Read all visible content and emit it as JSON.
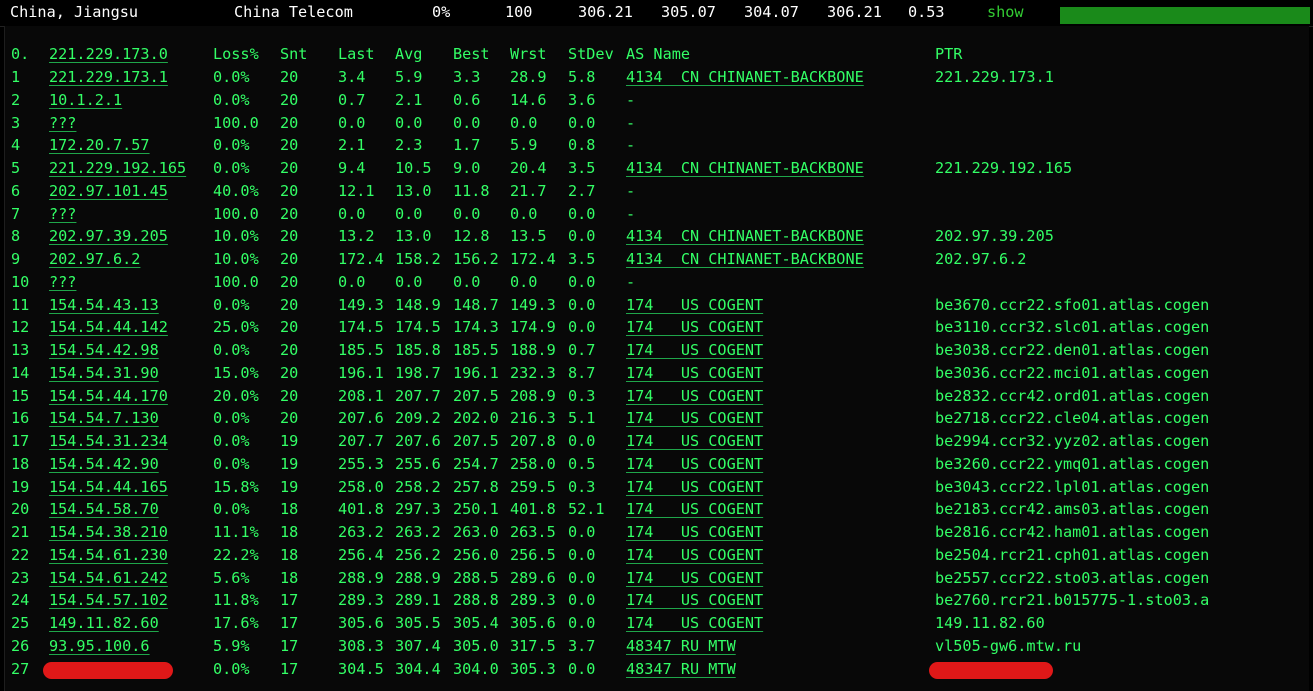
{
  "summary": {
    "location": "China, Jiangsu",
    "isp": "China Telecom",
    "loss": "0%",
    "sent": "100",
    "last": "306.21",
    "avg": "305.07",
    "best": "304.07",
    "worst": "306.21",
    "stdev": "0.53",
    "show_label": "show"
  },
  "headers": {
    "idx": "0.",
    "host": "221.229.173.0",
    "loss": "Loss%",
    "snt": "Snt",
    "last": "Last",
    "avg": "Avg",
    "best": "Best",
    "wrst": "Wrst",
    "stdev": "StDev",
    "as": "AS Name",
    "ptr": "PTR"
  },
  "hops": [
    {
      "idx": "1",
      "host": "221.229.173.1",
      "loss": "0.0%",
      "snt": "20",
      "last": "3.4",
      "avg": "5.9",
      "best": "3.3",
      "wrst": "28.9",
      "std": "5.8",
      "as": "4134  CN CHINANET-BACKBONE",
      "ptr": "221.229.173.1"
    },
    {
      "idx": "2",
      "host": "10.1.2.1",
      "loss": "0.0%",
      "snt": "20",
      "last": "0.7",
      "avg": "2.1",
      "best": "0.6",
      "wrst": "14.6",
      "std": "3.6",
      "as": "-",
      "ptr": ""
    },
    {
      "idx": "3",
      "host": "???",
      "loss": "100.0",
      "snt": "20",
      "last": "0.0",
      "avg": "0.0",
      "best": "0.0",
      "wrst": "0.0",
      "std": "0.0",
      "as": "-",
      "ptr": ""
    },
    {
      "idx": "4",
      "host": "172.20.7.57",
      "loss": "0.0%",
      "snt": "20",
      "last": "2.1",
      "avg": "2.3",
      "best": "1.7",
      "wrst": "5.9",
      "std": "0.8",
      "as": "-",
      "ptr": ""
    },
    {
      "idx": "5",
      "host": "221.229.192.165",
      "loss": "0.0%",
      "snt": "20",
      "last": "9.4",
      "avg": "10.5",
      "best": "9.0",
      "wrst": "20.4",
      "std": "3.5",
      "as": "4134  CN CHINANET-BACKBONE",
      "ptr": "221.229.192.165"
    },
    {
      "idx": "6",
      "host": "202.97.101.45",
      "loss": "40.0%",
      "snt": "20",
      "last": "12.1",
      "avg": "13.0",
      "best": "11.8",
      "wrst": "21.7",
      "std": "2.7",
      "as": "-",
      "ptr": ""
    },
    {
      "idx": "7",
      "host": "???",
      "loss": "100.0",
      "snt": "20",
      "last": "0.0",
      "avg": "0.0",
      "best": "0.0",
      "wrst": "0.0",
      "std": "0.0",
      "as": "-",
      "ptr": ""
    },
    {
      "idx": "8",
      "host": "202.97.39.205",
      "loss": "10.0%",
      "snt": "20",
      "last": "13.2",
      "avg": "13.0",
      "best": "12.8",
      "wrst": "13.5",
      "std": "0.0",
      "as": "4134  CN CHINANET-BACKBONE",
      "ptr": "202.97.39.205"
    },
    {
      "idx": "9",
      "host": "202.97.6.2",
      "loss": "10.0%",
      "snt": "20",
      "last": "172.4",
      "avg": "158.2",
      "best": "156.2",
      "wrst": "172.4",
      "std": "3.5",
      "as": "4134  CN CHINANET-BACKBONE",
      "ptr": "202.97.6.2"
    },
    {
      "idx": "10",
      "host": "???",
      "loss": "100.0",
      "snt": "20",
      "last": "0.0",
      "avg": "0.0",
      "best": "0.0",
      "wrst": "0.0",
      "std": "0.0",
      "as": "-",
      "ptr": ""
    },
    {
      "idx": "11",
      "host": "154.54.43.13",
      "loss": "0.0%",
      "snt": "20",
      "last": "149.3",
      "avg": "148.9",
      "best": "148.7",
      "wrst": "149.3",
      "std": "0.0",
      "as": "174   US COGENT",
      "ptr": "be3670.ccr22.sfo01.atlas.cogen"
    },
    {
      "idx": "12",
      "host": "154.54.44.142",
      "loss": "25.0%",
      "snt": "20",
      "last": "174.5",
      "avg": "174.5",
      "best": "174.3",
      "wrst": "174.9",
      "std": "0.0",
      "as": "174   US COGENT",
      "ptr": "be3110.ccr32.slc01.atlas.cogen"
    },
    {
      "idx": "13",
      "host": "154.54.42.98",
      "loss": "0.0%",
      "snt": "20",
      "last": "185.5",
      "avg": "185.8",
      "best": "185.5",
      "wrst": "188.9",
      "std": "0.7",
      "as": "174   US COGENT",
      "ptr": "be3038.ccr22.den01.atlas.cogen"
    },
    {
      "idx": "14",
      "host": "154.54.31.90",
      "loss": "15.0%",
      "snt": "20",
      "last": "196.1",
      "avg": "198.7",
      "best": "196.1",
      "wrst": "232.3",
      "std": "8.7",
      "as": "174   US COGENT",
      "ptr": "be3036.ccr22.mci01.atlas.cogen"
    },
    {
      "idx": "15",
      "host": "154.54.44.170",
      "loss": "20.0%",
      "snt": "20",
      "last": "208.1",
      "avg": "207.7",
      "best": "207.5",
      "wrst": "208.9",
      "std": "0.3",
      "as": "174   US COGENT",
      "ptr": "be2832.ccr42.ord01.atlas.cogen"
    },
    {
      "idx": "16",
      "host": "154.54.7.130",
      "loss": "0.0%",
      "snt": "20",
      "last": "207.6",
      "avg": "209.2",
      "best": "202.0",
      "wrst": "216.3",
      "std": "5.1",
      "as": "174   US COGENT",
      "ptr": "be2718.ccr22.cle04.atlas.cogen"
    },
    {
      "idx": "17",
      "host": "154.54.31.234",
      "loss": "0.0%",
      "snt": "19",
      "last": "207.7",
      "avg": "207.6",
      "best": "207.5",
      "wrst": "207.8",
      "std": "0.0",
      "as": "174   US COGENT",
      "ptr": "be2994.ccr32.yyz02.atlas.cogen"
    },
    {
      "idx": "18",
      "host": "154.54.42.90",
      "loss": "0.0%",
      "snt": "19",
      "last": "255.3",
      "avg": "255.6",
      "best": "254.7",
      "wrst": "258.0",
      "std": "0.5",
      "as": "174   US COGENT",
      "ptr": "be3260.ccr22.ymq01.atlas.cogen"
    },
    {
      "idx": "19",
      "host": "154.54.44.165",
      "loss": "15.8%",
      "snt": "19",
      "last": "258.0",
      "avg": "258.2",
      "best": "257.8",
      "wrst": "259.5",
      "std": "0.3",
      "as": "174   US COGENT",
      "ptr": "be3043.ccr22.lpl01.atlas.cogen"
    },
    {
      "idx": "20",
      "host": "154.54.58.70",
      "loss": "0.0%",
      "snt": "18",
      "last": "401.8",
      "avg": "297.3",
      "best": "250.1",
      "wrst": "401.8",
      "std": "52.1",
      "as": "174   US COGENT",
      "ptr": "be2183.ccr42.ams03.atlas.cogen"
    },
    {
      "idx": "21",
      "host": "154.54.38.210",
      "loss": "11.1%",
      "snt": "18",
      "last": "263.2",
      "avg": "263.2",
      "best": "263.0",
      "wrst": "263.5",
      "std": "0.0",
      "as": "174   US COGENT",
      "ptr": "be2816.ccr42.ham01.atlas.cogen"
    },
    {
      "idx": "22",
      "host": "154.54.61.230",
      "loss": "22.2%",
      "snt": "18",
      "last": "256.4",
      "avg": "256.2",
      "best": "256.0",
      "wrst": "256.5",
      "std": "0.0",
      "as": "174   US COGENT",
      "ptr": "be2504.rcr21.cph01.atlas.cogen"
    },
    {
      "idx": "23",
      "host": "154.54.61.242",
      "loss": "5.6%",
      "snt": "18",
      "last": "288.9",
      "avg": "288.9",
      "best": "288.5",
      "wrst": "289.6",
      "std": "0.0",
      "as": "174   US COGENT",
      "ptr": "be2557.ccr22.sto03.atlas.cogen"
    },
    {
      "idx": "24",
      "host": "154.54.57.102",
      "loss": "11.8%",
      "snt": "17",
      "last": "289.3",
      "avg": "289.1",
      "best": "288.8",
      "wrst": "289.3",
      "std": "0.0",
      "as": "174   US COGENT",
      "ptr": "be2760.rcr21.b015775-1.sto03.a"
    },
    {
      "idx": "25",
      "host": "149.11.82.60",
      "loss": "17.6%",
      "snt": "17",
      "last": "305.6",
      "avg": "305.5",
      "best": "305.4",
      "wrst": "305.6",
      "std": "0.0",
      "as": "174   US COGENT",
      "ptr": "149.11.82.60"
    },
    {
      "idx": "26",
      "host": "93.95.100.6",
      "loss": "5.9%",
      "snt": "17",
      "last": "308.3",
      "avg": "307.4",
      "best": "305.0",
      "wrst": "317.5",
      "std": "3.7",
      "as": "48347 RU MTW",
      "ptr": "vl505-gw6.mtw.ru"
    },
    {
      "idx": "27",
      "host": "",
      "loss": "0.0%",
      "snt": "17",
      "last": "304.5",
      "avg": "304.4",
      "best": "304.0",
      "wrst": "305.3",
      "std": "0.0",
      "as": "48347 RU MTW",
      "ptr": ""
    }
  ],
  "colors": {
    "text": "#33ff66",
    "summary_text": "#ffffff",
    "bar": "#1a8a1a",
    "redaction": "#e01818",
    "background": "#000000"
  }
}
